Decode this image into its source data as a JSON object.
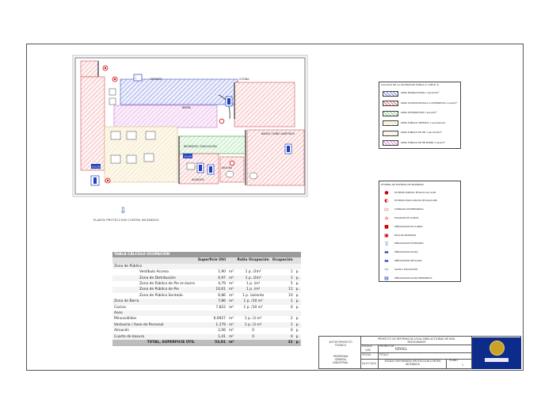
{
  "plan": {
    "labels": {
      "barra": "BARRA",
      "estante": "ESTANTE",
      "cocina": "COCINA",
      "recibidor": "RECIBIDOR / EVACUACION",
      "banos": "BAÑOS / BAÑO ADAPTADO",
      "almacen": "ALMACEN",
      "basura": "BASURA"
    },
    "caption": "PLANTA PROTECCION CONTRA INCENDIOS"
  },
  "zone_legend": {
    "title": "CALCULO DE LA OCUPACION (TABLA 2.1 DB-SI 3)",
    "items": [
      {
        "text": "ZONA BARRA/COCINA 1 pers/10m²",
        "color": "#7a86d6"
      },
      {
        "text": "ZONA OCUPACION NULA O ALTERNATIVA 1 pers/m²",
        "color": "#e07070"
      },
      {
        "text": "ZONA DISTRIBUCION 1 pers/2m²",
        "color": "#8fd08f"
      },
      {
        "text": "ZONA PUBLICO SENTADO 1 pers/asiento",
        "color": "#e8d9a0"
      },
      {
        "text": "ZONA PUBLICO DE PIE 1 pers/0,50m²",
        "color": "#f2e3bb"
      },
      {
        "text": "ZONA PUBLICO DE PIE BARRA 1 pers/m²",
        "color": "#d98ad9"
      }
    ]
  },
  "symbol_legend": {
    "title": "LEYENDA DE SISTEMAS DE INCENDIOS",
    "items": [
      {
        "icon": "fire-extinguisher-icon",
        "text": "EXTINTOR PORTATIL EFICACIA 21A-113B"
      },
      {
        "icon": "co2-extinguisher-icon",
        "text": "EXTINTOR POLVO ABC/CO2 EFICACIA 89B"
      },
      {
        "icon": "emergency-light-icon",
        "text": "LUMINARIA DE EMERGENCIA"
      },
      {
        "icon": "alarm-icon",
        "text": "PULSADOR DE ALARMA"
      },
      {
        "icon": "siren-icon",
        "text": "SEÑALIZACION DE ALARMA"
      },
      {
        "icon": "fire-hose-icon",
        "text": "BOCA DE INCENDIOS"
      },
      {
        "icon": "exit-sign-icon",
        "text": "SEÑALIZACION EXTINTORES"
      },
      {
        "icon": "salida-icon",
        "text": "SEÑALIZACION SALIDA"
      },
      {
        "icon": "no-exit-icon",
        "text": "SEÑALIZACION SIN SALIDA"
      },
      {
        "icon": "direction-arrow-icon",
        "text": "SALIDA / EVACUACION"
      },
      {
        "icon": "emergency-exit-icon",
        "text": "SEÑALIZACION SALIDA EMERGENCIA"
      }
    ]
  },
  "table": {
    "title": "TABLA CÁLCULO OCUPACIÓN",
    "columns": [
      "",
      "Superficie Útil",
      "",
      "Ratio Ocupación",
      "Ocupación",
      ""
    ],
    "rows": [
      {
        "name": "Zona de Público",
        "indent": 0,
        "sup": "",
        "unit": "",
        "ratio": "",
        "ocu": "",
        "p": ""
      },
      {
        "name": "Vestíbulo Acceso",
        "indent": 2,
        "sup": "1,90",
        "unit": "m²",
        "ratio": "1 p. /2m²",
        "ocu": "1",
        "p": "p."
      },
      {
        "name": "Zona de Distribución",
        "indent": 2,
        "sup": "0,97",
        "unit": "m²",
        "ratio": "1 p. /2m²",
        "ocu": "1",
        "p": "p."
      },
      {
        "name": "Zona de Público de Pie en barra",
        "indent": 2,
        "sup": "4,79",
        "unit": "m²",
        "ratio": "1 p. /m²",
        "ocu": "5",
        "p": "p."
      },
      {
        "name": "Zona de Público de Pie",
        "indent": 2,
        "sup": "10,61",
        "unit": "m²",
        "ratio": "1 p. /m²",
        "ocu": "11",
        "p": "p."
      },
      {
        "name": "Zona de Público Sentado",
        "indent": 2,
        "sup": "6,86",
        "unit": "m²",
        "ratio": "1 p. /asiento",
        "ocu": "10",
        "p": "p."
      },
      {
        "name": "Zona de Barra",
        "indent": 0,
        "sup": "7,86",
        "unit": "m²",
        "ratio": "1 p. /10 m²",
        "ocu": "1",
        "p": "p."
      },
      {
        "name": "Cocina",
        "indent": 0,
        "sup": "7,822",
        "unit": "m²",
        "ratio": "1 p. /10 m²",
        "ocu": "0",
        "p": "p."
      },
      {
        "name": "Aseo",
        "indent": 0,
        "sup": "",
        "unit": "",
        "ratio": "",
        "ocu": "",
        "p": ""
      },
      {
        "name": "Minusválidos",
        "indent": 0,
        "sup": "6,9927",
        "unit": "m²",
        "ratio": "1 p. /3 m²",
        "ocu": "2",
        "p": "p."
      },
      {
        "name": "Vestuario / Aseo de Personal",
        "indent": 0,
        "sup": "1,179",
        "unit": "m²",
        "ratio": "1 p. /3 m²",
        "ocu": "1",
        "p": "p."
      },
      {
        "name": "Almacén",
        "indent": 0,
        "sup": "2,06",
        "unit": "m²",
        "ratio": "0",
        "ocu": "0",
        "p": "p."
      },
      {
        "name": "Cuarto de basura",
        "indent": 0,
        "sup": "1,41",
        "unit": "m²",
        "ratio": "0",
        "ocu": "0",
        "p": "p."
      }
    ],
    "total": {
      "label": "TOTAL, SUPERFICIE ÚTIL",
      "sup": "53,91",
      "unit": "m²",
      "ocu": "32",
      "p": "p."
    }
  },
  "title_block": {
    "left_top": "AUTOR PROYECTO TECNICO",
    "left_bottom": "PROPIEDAD GENERAL INDUSTRIAL",
    "project": "PROYECTO DE REFORMA DE LOCAL PARA ACTIVIDAD DE BAR-RESTAURANTE",
    "escala_label": "ESCALA:",
    "escala_value": "1/50",
    "promotor_label": "PROMOTOR",
    "promotor_value": "ISRAEL",
    "fecha_label": "FECHA:",
    "fecha_value": "04.07.2022",
    "titulo_label": "TITULO",
    "titulo_value": "ESTADO REFORMADO PROTECCION CONTRA INCENDIOS",
    "plano_label": "PLANO",
    "plano_value": "1"
  }
}
